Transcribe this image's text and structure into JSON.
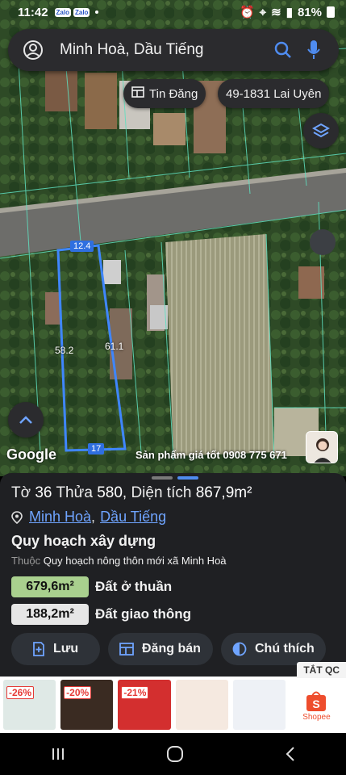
{
  "status": {
    "time": "11:42",
    "app_badges": [
      "Zalo",
      "Zalo"
    ],
    "battery": "81%"
  },
  "search": {
    "query": "Minh Hoà, Dầu Tiếng"
  },
  "chips": {
    "listing": "Tin Đăng",
    "phone_listing": "49-1831 Lai Uyên"
  },
  "map": {
    "dimensions": {
      "top": "12.4",
      "left": "58.2",
      "right": "61.1",
      "bottom": "17"
    },
    "google_label": "Google",
    "ad_text": "Sản phẩm giá tốt 0908 775 671"
  },
  "sheet": {
    "parcel": {
      "to_label": "Tờ",
      "to_value": "36",
      "thua_label": "Thửa",
      "thua_value": "580",
      "area_label": "Diện tích",
      "area_value": "867,9m²"
    },
    "location": {
      "ward": "Minh Hoà",
      "district": "Dầu Tiếng"
    },
    "plan_title": "Quy hoạch xây dựng",
    "plan_prefix": "Thuộc",
    "plan_name": "Quy hoạch nông thôn mới xã Minh Hoà",
    "zones": [
      {
        "area": "679,6m²",
        "label": "Đất ở thuần",
        "color": "#a9d08e"
      },
      {
        "area": "188,2m²",
        "label": "Đất giao thông",
        "color": "#e6e6e6"
      }
    ],
    "actions": {
      "save": "Lưu",
      "sell": "Đăng bán",
      "legend": "Chú thích"
    }
  },
  "ads": {
    "close_label": "TẮT QC",
    "items": [
      {
        "discount": "-26%",
        "color": "#dfe9e6"
      },
      {
        "discount": "-20%",
        "color": "#3a2b22"
      },
      {
        "discount": "-21%",
        "color": "#d32f2f"
      },
      {
        "discount": "",
        "color": "#f5e9e0"
      },
      {
        "discount": "",
        "color": "#eef1f6"
      },
      {
        "discount": "",
        "color": "#ffffff",
        "brand": "Shopee"
      }
    ]
  },
  "colors": {
    "accent_blue": "#4f8cf0",
    "link_blue": "#6fa4ff",
    "parcel_outline": "#3f86ff",
    "sheet_bg": "#1f2023"
  }
}
